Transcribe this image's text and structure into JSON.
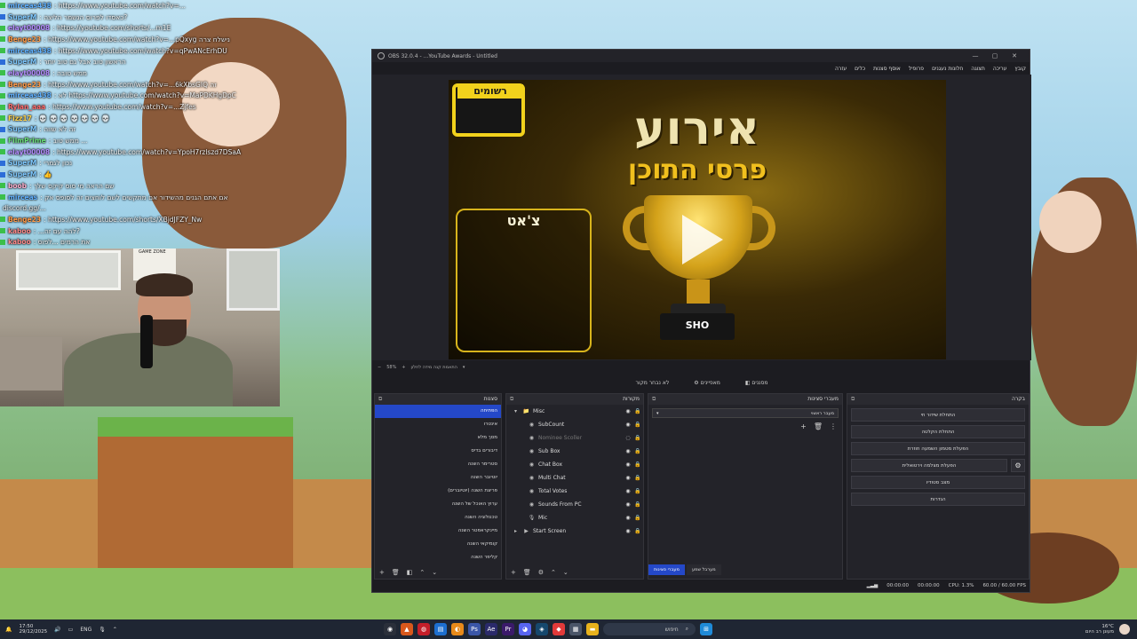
{
  "chat": [
    {
      "user": "mirceas438",
      "msg": ": https://www.youtube.com/watch?v=...",
      "color": "#5fb0ff",
      "badge": "green"
    },
    {
      "user": "SuperM",
      "msg": ": כאסדו לפרוס הנשמר הליצה?",
      "color": "#7ec8ff",
      "badge": "blue"
    },
    {
      "user": "elayt00008",
      "msg": ": https://youtube.com/shorts/...m1E",
      "color": "#b48cff",
      "badge": "green"
    },
    {
      "user": "Benge23",
      "msg": ": https://www.youtube.com/watch?v=...pQxyg נישלח צרה",
      "color": "#ff9b4a",
      "badge": "green"
    },
    {
      "user": "mirceas438",
      "msg": ": https://www.youtube.com/watch?v=qPwANcErhDU",
      "color": "#5fb0ff",
      "badge": "green"
    },
    {
      "user": "SuperM",
      "msg": ": הראשון טוב אבל גם טוב יותר",
      "color": "#7ec8ff",
      "badge": "blue"
    },
    {
      "user": "elayt00008",
      "msg": ": ממש טובה",
      "color": "#b48cff",
      "badge": "green"
    },
    {
      "user": "Benge23",
      "msg": ": https://www.youtube.com/watch?v=...6kXbsGIQ זה",
      "color": "#ff9b4a",
      "badge": "green"
    },
    {
      "user": "mirceas438",
      "msg": ": לא https://www.youtube.com/watch?v=MaPDKHgDpC",
      "color": "#5fb0ff",
      "badge": "green"
    },
    {
      "user": "Rylan_aaa",
      "msg": ": https://www.youtube.com/watch?v=...Zjfes",
      "color": "#ff6b6b",
      "badge": "green"
    },
    {
      "user": "Fizz17",
      "msg": ": 💀 💀 💀 💀 💀 💀 💀",
      "color": "#ffd24a",
      "badge": "green"
    },
    {
      "user": "SuperM",
      "msg": ": זה לא שווה",
      "color": "#7ec8ff",
      "badge": "blue"
    },
    {
      "user": "FilmPrime",
      "msg": ": ממש טוב ...",
      "color": "#6be07a",
      "badge": "green"
    },
    {
      "user": "elayt00008",
      "msg": ": https://www.youtube.com/watch?v=YpoH7rzlszd7DSaA",
      "color": "#b48cff",
      "badge": "green"
    },
    {
      "user": "SuperM",
      "msg": ": נכון לגמרי",
      "color": "#7ec8ff",
      "badge": "blue"
    },
    {
      "user": "SuperM",
      "msg": ": 👍",
      "color": "#7ec8ff",
      "badge": "blue"
    },
    {
      "user": "boob",
      "msg": ": שם הראה מי סוס קיקס שלך",
      "color": "#ffb0d0",
      "badge": "green"
    },
    {
      "user": "mirceas",
      "msg": ": אם אתם הגנים מהשידור אם מתקשים לשם לוחצים זה לסופס אק",
      "color": "#5fb0ff",
      "badge": "green"
    },
    {
      "user": "",
      "msg": "discord.gg/...",
      "color": "#ffffff",
      "badge": "none"
    },
    {
      "user": "Benge23",
      "msg": ": https://www.youtube.com/shorts/XBjdJFZY_Nw",
      "color": "#ff9b4a",
      "badge": "green"
    },
    {
      "user": "kaboo",
      "msg": ": ...להה עם זה?",
      "color": "#ff8a8a",
      "badge": "green"
    },
    {
      "user": "kaboo",
      "msg": ": את הרמים ...לפוס",
      "color": "#ff8a8a",
      "badge": "green"
    }
  ],
  "webcam": {
    "poster_text": "GAME ZONE"
  },
  "obs": {
    "title": "OBS 32.0.4 - ...YouTube Awards - Untitled",
    "menu": [
      "קובץ",
      "עריכה",
      "תצוגה",
      "חלונות נעגנים",
      "פרופיל",
      "אוסף סצנות",
      "כלים",
      "עזרה"
    ],
    "overlay": {
      "rec_label": "רשומים",
      "chat_label": "צ'אט",
      "headline": "אירוע",
      "subheadline": "פרסי התוכן",
      "trophy_base": "SHO"
    },
    "preview_bar": {
      "zoom": "58%",
      "mode": "התאמת קנה מידה לחלון"
    },
    "mode_bar": {
      "no_source": "לא נבחר מקור",
      "properties": "מאפיינים",
      "filters": "מסננים"
    },
    "scenes": {
      "title": "סצנות",
      "items": [
        "הפתיחה",
        "אינטרו",
        "מסך מלא",
        "דיבורים בדיס",
        "סטרימר השנה",
        "יוטיובר השנה",
        "פריצת השנה (יוטיוברים)",
        "ערוץ האוכל של השנה",
        "טכנולוגיה השנה",
        "מיינקראפטר השנה",
        "קומיקאי השנה",
        "קליפר השנה"
      ],
      "active_index": 0
    },
    "sources": {
      "title": "מקורות",
      "items": [
        {
          "name": "Misc",
          "icon": "folder-icon",
          "glyph": "📁",
          "child": false,
          "dim": false,
          "expander": "▾"
        },
        {
          "name": "SubCount",
          "icon": "browser-icon",
          "glyph": "◉",
          "child": true,
          "dim": false,
          "expander": ""
        },
        {
          "name": "Nominee Scoller",
          "icon": "browser-icon",
          "glyph": "◉",
          "child": true,
          "dim": true,
          "expander": ""
        },
        {
          "name": "Sub Box",
          "icon": "browser-icon",
          "glyph": "◉",
          "child": true,
          "dim": false,
          "expander": ""
        },
        {
          "name": "Chat Box",
          "icon": "browser-icon",
          "glyph": "◉",
          "child": true,
          "dim": false,
          "expander": ""
        },
        {
          "name": "Multi Chat",
          "icon": "browser-icon",
          "glyph": "◉",
          "child": true,
          "dim": false,
          "expander": ""
        },
        {
          "name": "Total Votes",
          "icon": "browser-icon",
          "glyph": "◉",
          "child": true,
          "dim": false,
          "expander": ""
        },
        {
          "name": "Sounds From PC",
          "icon": "speaker-icon",
          "glyph": "◉",
          "child": true,
          "dim": false,
          "expander": ""
        },
        {
          "name": "Mic",
          "icon": "mic-icon",
          "glyph": "🎙",
          "child": true,
          "dim": false,
          "expander": ""
        },
        {
          "name": "Start Screen",
          "icon": "media-icon",
          "glyph": "▶",
          "child": false,
          "dim": false,
          "expander": "▸"
        }
      ]
    },
    "transitions": {
      "title": "מעברי סצינות",
      "selected": "מעבר ראשוי",
      "tabs": [
        "מעברי סצינות",
        "מערבל שמע"
      ]
    },
    "controls": {
      "title": "בקרה",
      "buttons": [
        "התחלת שידור חי",
        "התחלת הקלטה",
        "הפעלת מטמון השמעה חוזרת",
        "הפעלת מצלמה וירטואלית",
        "מצב סטודיו",
        "הגדרות"
      ]
    },
    "status": {
      "rec_time": "00:00:00",
      "stream_time": "00:00:00",
      "cpu": "CPU: 1.3%",
      "fps": "60.00 / 60.00 FPS"
    }
  },
  "taskbar": {
    "time": "17:50",
    "date": "29/12/2025",
    "lang": "ENG",
    "search_label": "חיפוש",
    "weather_temp": "16°C",
    "weather_desc": "מעונן רב היום"
  }
}
